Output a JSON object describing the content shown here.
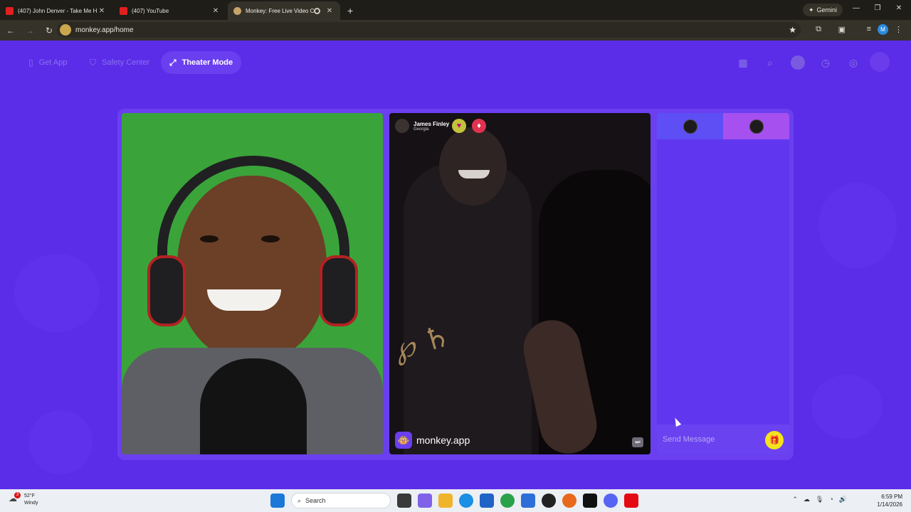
{
  "browser": {
    "tabs": [
      {
        "title": "(407) John Denver - Take Me H",
        "favicon": "youtube-icon",
        "active": false
      },
      {
        "title": "(407) YouTube",
        "favicon": "youtube-icon",
        "active": false
      },
      {
        "title": "Monkey: Free Live Video Ch",
        "favicon": "monkey-icon",
        "active": true
      }
    ],
    "new_tab_symbol": "+",
    "gemini_label": "Gemini",
    "url": "monkey.app/home",
    "profile_initial": "M"
  },
  "page": {
    "nav": {
      "get_app": "Get App",
      "safety_center": "Safety Center",
      "theater_mode": "Theater Mode"
    },
    "peer": {
      "name": "James Finley",
      "location": "Georgia"
    },
    "brand": "monkey.app",
    "chat": {
      "placeholder": "Send Message"
    }
  },
  "taskbar": {
    "weather_temp": "52°F",
    "weather_desc": "Windy",
    "weather_badge": "3",
    "search_label": "Search",
    "time": "6:59 PM",
    "date": "1/14/2026"
  },
  "colors": {
    "page_bg": "#5b2de8",
    "accent": "#6a3ff0",
    "gift_yellow": "#f4e21c"
  }
}
